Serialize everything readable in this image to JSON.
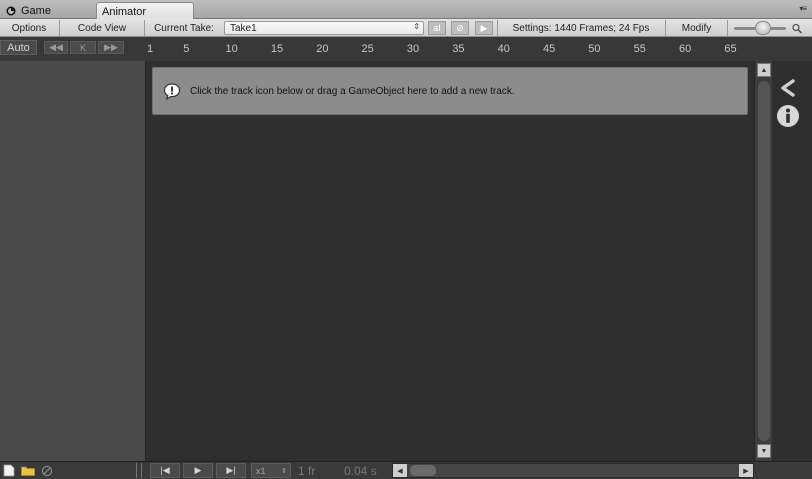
{
  "tabs": [
    {
      "label": "Game",
      "icon": "game-controller-icon",
      "active": false
    },
    {
      "label": "Animator",
      "active": true
    }
  ],
  "toolbar": {
    "options_label": "Options",
    "code_view_label": "Code View",
    "current_take_label": "Current Take:",
    "take_value": "Take1",
    "settings_label": "Settings: 1440 Frames; 24 Fps",
    "modify_label": "Modify"
  },
  "ruler": {
    "auto_label": "Auto",
    "key_label": "K",
    "ticks": [
      "1",
      "5",
      "10",
      "15",
      "20",
      "25",
      "30",
      "35",
      "40",
      "45",
      "50",
      "55",
      "60",
      "65"
    ]
  },
  "notice": {
    "text": "Click the track icon below or drag a GameObject here to add a new track."
  },
  "bottom": {
    "speed_value": "x1",
    "frame_readout": "1 fr",
    "time_readout": "0.04 s"
  },
  "colors": {
    "panel_dark": "#2f2f2f",
    "panel_left": "#4a4a4a",
    "notice_bg": "#8c8c8c",
    "toolbar_bg": "#d9d9d9"
  }
}
